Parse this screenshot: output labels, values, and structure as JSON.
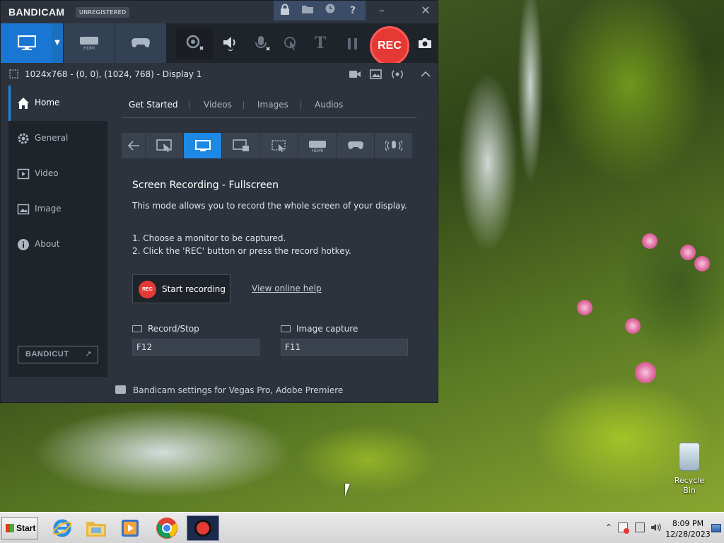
{
  "app": {
    "logo_main": "BANDICAM",
    "unregistered": "UNREGISTERED",
    "titlebar_icons": [
      "lock-icon",
      "folder-icon",
      "clock-icon",
      "help-icon"
    ],
    "window_controls": {
      "minimize": "–",
      "close": "✕"
    }
  },
  "toolbar": {
    "rec_label": "REC",
    "modes": [
      "screen-recording-mode",
      "device-recording-mode",
      "game-recording-mode"
    ],
    "tools": [
      "webcam-overlay-icon",
      "speaker-icon",
      "microphone-icon",
      "cursor-effects-icon",
      "text-overlay-icon",
      "pause-icon",
      "screenshot-icon"
    ]
  },
  "areabar": {
    "text": "1024x768 - (0, 0), (1024, 768) - Display 1"
  },
  "sidebar": {
    "items": [
      {
        "label": "Home",
        "icon": "home-icon",
        "active": true
      },
      {
        "label": "General",
        "icon": "gear-icon",
        "active": false
      },
      {
        "label": "Video",
        "icon": "video-icon",
        "active": false
      },
      {
        "label": "Image",
        "icon": "image-icon",
        "active": false
      },
      {
        "label": "About",
        "icon": "info-icon",
        "active": false
      }
    ],
    "bandicut": "BANDICUT",
    "bandicut_arrow": "↗"
  },
  "content": {
    "tabs": [
      "Get Started",
      "Videos",
      "Images",
      "Audios"
    ],
    "mode_icons": [
      "back-arrow-icon",
      "select-area-icon",
      "fullscreen-icon",
      "window-lock-icon",
      "around-mouse-icon",
      "hdmi-device-icon",
      "game-controller-icon",
      "audio-only-icon"
    ],
    "section_title": "Screen Recording - Fullscreen",
    "section_desc": "This mode allows you to record the whole screen of your display.",
    "step1": "1. Choose a monitor to be captured.",
    "step2": "2. Click the 'REC' button or press the record hotkey.",
    "start_badge": "REC",
    "start_label": "Start recording",
    "help_link": "View online help",
    "hotkeys": [
      {
        "label": "Record/Stop",
        "value": "F12"
      },
      {
        "label": "Image capture",
        "value": "F11"
      }
    ]
  },
  "footer": {
    "text": "Bandicam settings for Vegas Pro, Adobe Premiere"
  },
  "desktop": {
    "recycle_bin": "Recycle Bin"
  },
  "taskbar": {
    "start": "Start",
    "apps": [
      "internet-explorer-icon",
      "file-explorer-icon",
      "media-player-icon",
      "chrome-icon",
      "bandicam-icon"
    ],
    "time": "8:09 PM",
    "date": "12/28/2023"
  },
  "colors": {
    "accent_blue": "#1e88e5",
    "rec_red": "#e53935",
    "panel_dark": "#1f242b",
    "panel_mid": "#2d333c"
  }
}
